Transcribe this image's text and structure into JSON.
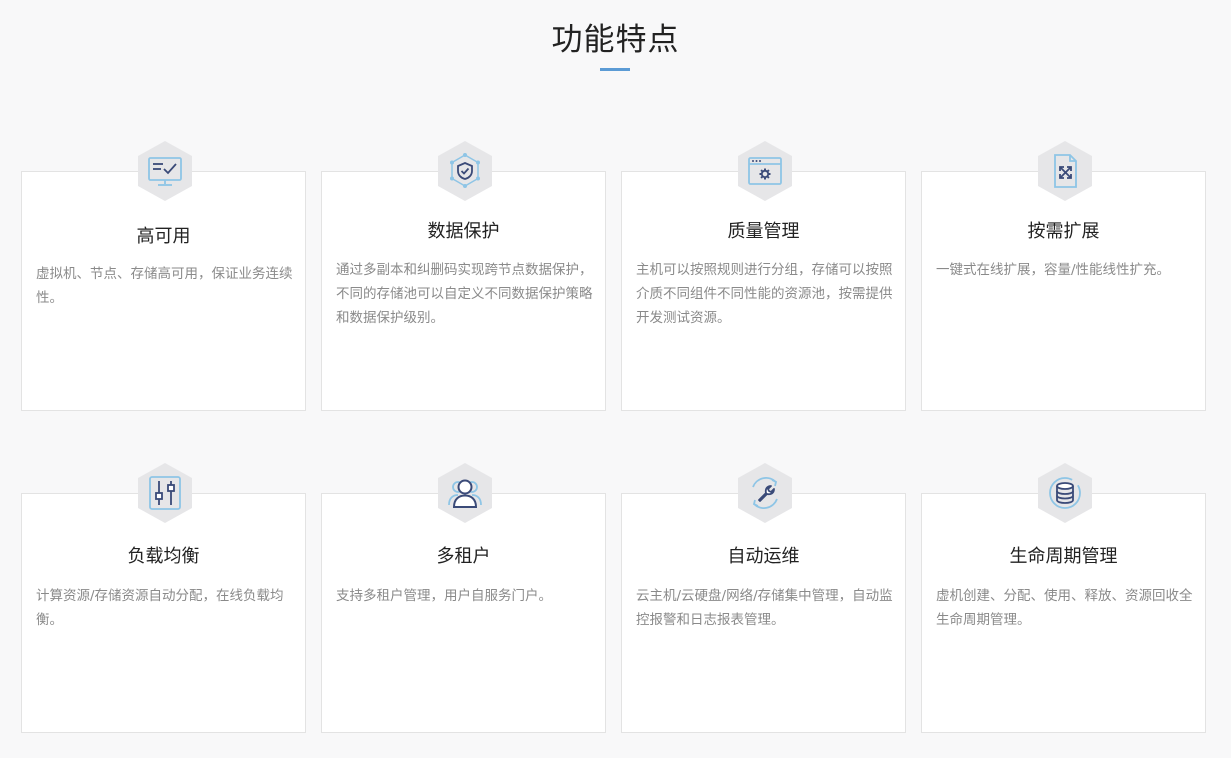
{
  "section": {
    "title": "功能特点"
  },
  "features": [
    {
      "title": "高可用",
      "desc": "虚拟机、节点、存储高可用，保证业务连续性。",
      "icon": "monitor-check-icon"
    },
    {
      "title": "数据保护",
      "desc": "通过多副本和纠删码实现跨节点数据保护，不同的存储池可以自定义不同数据保护策略和数据保护级别。",
      "icon": "shield-network-icon"
    },
    {
      "title": "质量管理",
      "desc": "主机可以按照规则进行分组，存储可以按照介质不同组件不同性能的资源池，按需提供开发测试资源。",
      "icon": "browser-gear-icon"
    },
    {
      "title": "按需扩展",
      "desc": "一键式在线扩展，容量/性能线性扩充。",
      "icon": "document-expand-icon"
    },
    {
      "title": "负载均衡",
      "desc": "计算资源/存储资源自动分配，在线负载均衡。",
      "icon": "sliders-icon"
    },
    {
      "title": "多租户",
      "desc": "支持多租户管理，用户自服务门户。",
      "icon": "users-icon"
    },
    {
      "title": "自动运维",
      "desc": "云主机/云硬盘/网络/存储集中管理，自动监控报警和日志报表管理。",
      "icon": "wrench-cycle-icon"
    },
    {
      "title": "生命周期管理",
      "desc": "虚机创建、分配、使用、释放、资源回收全生命周期管理。",
      "icon": "database-cycle-icon"
    }
  ],
  "colors": {
    "accent": "#5b9bd5",
    "icon_dark": "#3a4a78",
    "icon_light": "#8ec5e6",
    "hex_bg": "#e6e6e8"
  }
}
